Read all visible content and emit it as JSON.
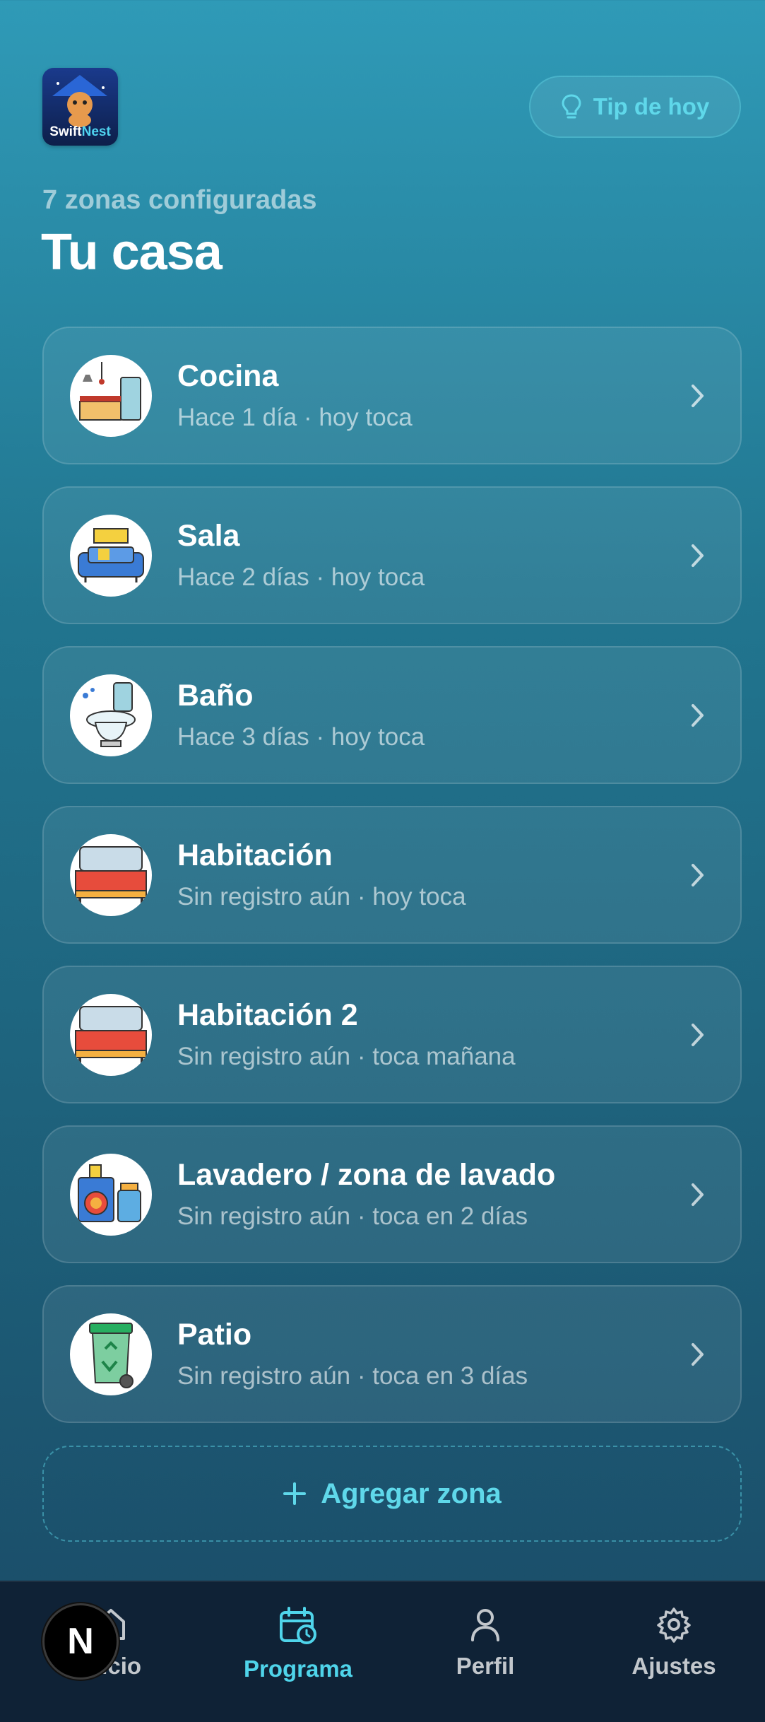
{
  "app": {
    "logo_text_1": "Swift",
    "logo_text_2": "Nest"
  },
  "header": {
    "tip_label": "Tip de hoy",
    "subtitle": "7 zonas configuradas",
    "title": "Tu casa"
  },
  "zones": [
    {
      "name": "Cocina",
      "status": "Hace 1 día · hoy toca",
      "icon": "kitchen-icon"
    },
    {
      "name": "Sala",
      "status": "Hace 2 días · hoy toca",
      "icon": "sofa-icon"
    },
    {
      "name": "Baño",
      "status": "Hace 3 días · hoy toca",
      "icon": "toilet-icon"
    },
    {
      "name": "Habitación",
      "status": "Sin registro aún · hoy toca",
      "icon": "bed-icon"
    },
    {
      "name": "Habitación 2",
      "status": "Sin registro aún · toca mañana",
      "icon": "bed-icon"
    },
    {
      "name": "Lavadero / zona de lavado",
      "status": "Sin registro aún · toca en 2 días",
      "icon": "washing-machine-icon"
    },
    {
      "name": "Patio",
      "status": "Sin registro aún · toca en 3 días",
      "icon": "trash-bin-icon"
    }
  ],
  "add_zone_label": "Agregar zona",
  "nav": {
    "items": [
      {
        "label": "Inicio",
        "icon": "home-icon"
      },
      {
        "label": "Programa",
        "icon": "calendar-clock-icon",
        "active": true
      },
      {
        "label": "Perfil",
        "icon": "user-icon"
      },
      {
        "label": "Ajustes",
        "icon": "gear-icon"
      }
    ],
    "badge": "N"
  },
  "colors": {
    "accent": "#5fd8ea",
    "nav_bg": "#0f2236"
  }
}
